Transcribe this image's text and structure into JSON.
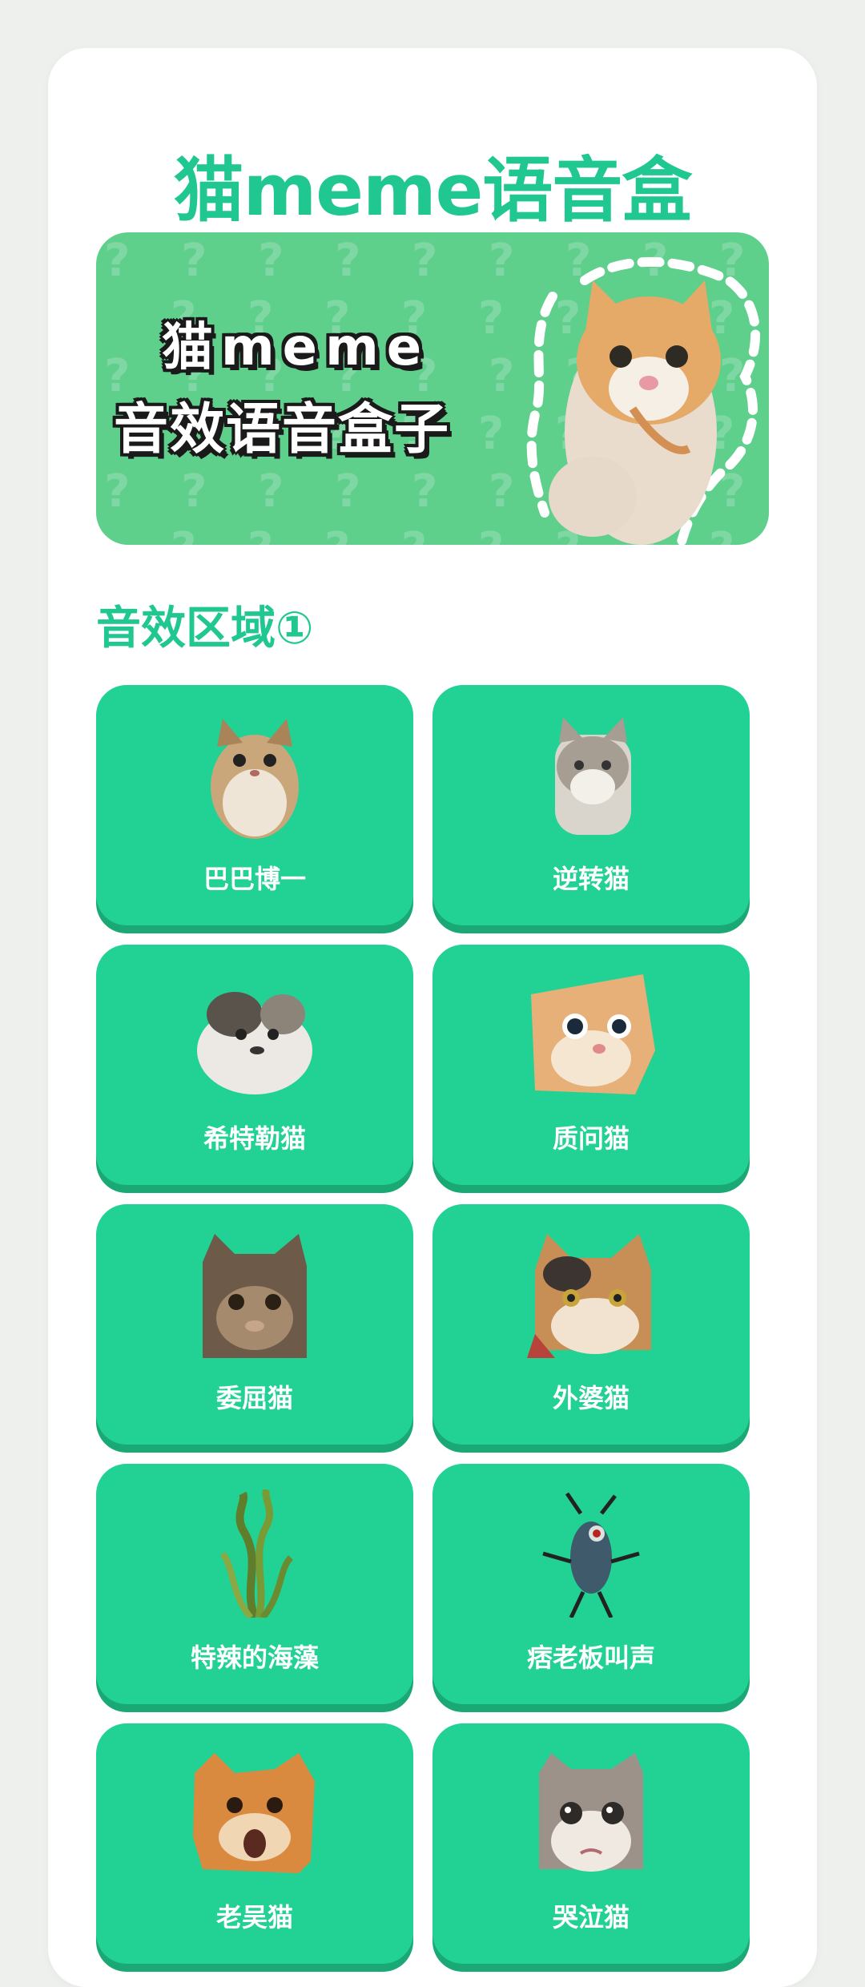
{
  "app": {
    "title": "猫meme语音盒"
  },
  "banner": {
    "line1": "猫meme",
    "line2": "音效语音盒子",
    "pattern": "?"
  },
  "section": {
    "title": "音效区域①"
  },
  "sounds": [
    {
      "label": "巴巴博一",
      "icon": "round-tabby-cat"
    },
    {
      "label": "逆转猫",
      "icon": "grey-white-cat"
    },
    {
      "label": "希特勒猫",
      "icon": "white-grey-cat"
    },
    {
      "label": "质问猫",
      "icon": "orange-questioning-cat"
    },
    {
      "label": "委屈猫",
      "icon": "sad-tabby-cat"
    },
    {
      "label": "外婆猫",
      "icon": "calico-cat"
    },
    {
      "label": "特辣的海藻",
      "icon": "seaweed"
    },
    {
      "label": "痞老板叫声",
      "icon": "plankton-character"
    },
    {
      "label": "老吴猫",
      "icon": "orange-yelling-cat"
    },
    {
      "label": "哭泣猫",
      "icon": "crying-cat"
    }
  ],
  "colors": {
    "accent": "#21c791",
    "tile": "#22d194",
    "tile_shadow": "#1aa874",
    "banner": "#5fcf8c"
  }
}
